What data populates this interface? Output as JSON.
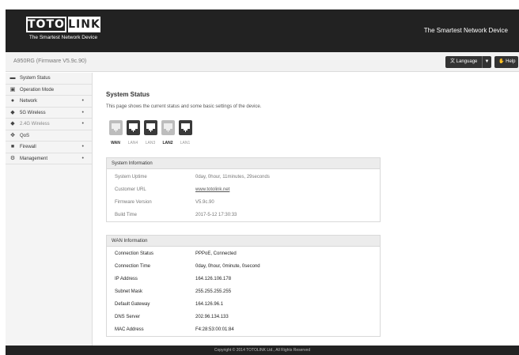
{
  "brand": {
    "logo_left": "TOTO",
    "logo_right": "LINK",
    "tagline": "The Smartest Network Device",
    "header_slogan": "The Smartest Network Device"
  },
  "toolbar": {
    "model": "A950RG (Firmware V5.9c.90)",
    "language_label": "Language",
    "help_label": "Help"
  },
  "sidebar": {
    "items": [
      {
        "label": "System Status",
        "icon": "monitor-icon",
        "expandable": false
      },
      {
        "label": "Operation Mode",
        "icon": "window-icon",
        "expandable": false
      },
      {
        "label": "Network",
        "icon": "globe-icon",
        "expandable": true
      },
      {
        "label": "5G Wireless",
        "icon": "wifi-icon",
        "expandable": true
      },
      {
        "label": "2.4G Wireless",
        "icon": "wifi-icon",
        "expandable": true
      },
      {
        "label": "QoS",
        "icon": "gear-icon",
        "expandable": false
      },
      {
        "label": "Firewall",
        "icon": "lock-icon",
        "expandable": true
      },
      {
        "label": "Management",
        "icon": "settings-icon",
        "expandable": true
      }
    ]
  },
  "main": {
    "title": "System Status",
    "description": "This page shows the current status and some basic settings of the device.",
    "ports": [
      {
        "label": "WAN",
        "active": true
      },
      {
        "label": "LAN4",
        "active": false
      },
      {
        "label": "LAN3",
        "active": false
      },
      {
        "label": "LAN2",
        "active": true
      },
      {
        "label": "LAN1",
        "active": false
      }
    ],
    "system_info": {
      "heading": "System Information",
      "rows": [
        {
          "key": "System Uptime",
          "value": "0day, 0hour, 11minutes, 29seconds"
        },
        {
          "key": "Customer URL",
          "value": "www.totolink.net"
        },
        {
          "key": "Firmware Version",
          "value": "V5.9c.90"
        },
        {
          "key": "Build Time",
          "value": "2017-5-12 17:30:33"
        }
      ]
    },
    "wan_info": {
      "heading": "WAN Information",
      "rows": [
        {
          "key": "Connection Status",
          "value": "PPPoE, Connected"
        },
        {
          "key": "Connection Time",
          "value": "0day, 0hour, 0minute, 0second"
        },
        {
          "key": "IP Address",
          "value": "164.126.106.178"
        },
        {
          "key": "Subnet Mask",
          "value": "255.255.255.255"
        },
        {
          "key": "Default Gateway",
          "value": "164.126.96.1"
        },
        {
          "key": "DNS Server",
          "value": "202.96.134.133"
        },
        {
          "key": "MAC Address",
          "value": "F4:28:53:00:01:84"
        }
      ]
    }
  },
  "footer": {
    "text": "Copyright © 2014 TOTOLINK Ltd.,  All Rights Reserved"
  },
  "colors": {
    "header": "#222222",
    "port_dark": "#3a3a3a",
    "port_light": "#bdbdbd",
    "sidebar_bg": "#f4f4f4"
  }
}
